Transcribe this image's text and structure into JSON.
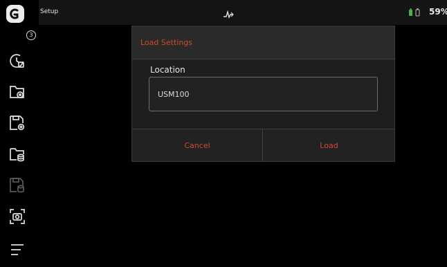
{
  "statusbar": {
    "title": "Setup",
    "percent": "59%",
    "icons": {
      "mode": "a-scan-trace-icon",
      "battery": "battery-icon"
    }
  },
  "sidebar": {
    "badge": "3",
    "items": [
      {
        "icon": "clock-settings-icon"
      },
      {
        "icon": "folder-settings-icon"
      },
      {
        "icon": "save-settings-icon"
      },
      {
        "icon": "folder-database-icon"
      },
      {
        "icon": "save-database-icon",
        "disabled": true
      },
      {
        "icon": "screenshot-icon"
      },
      {
        "icon": "menu-icon"
      }
    ]
  },
  "dialog": {
    "title": "Load Settings",
    "location_label": "Location",
    "location_value": "USM100",
    "cancel_label": "Cancel",
    "load_label": "Load"
  },
  "colors": {
    "accent": "#d24a2a",
    "battery": "#4caf50",
    "background": "#000000",
    "dialog": "#1e1e1e"
  }
}
